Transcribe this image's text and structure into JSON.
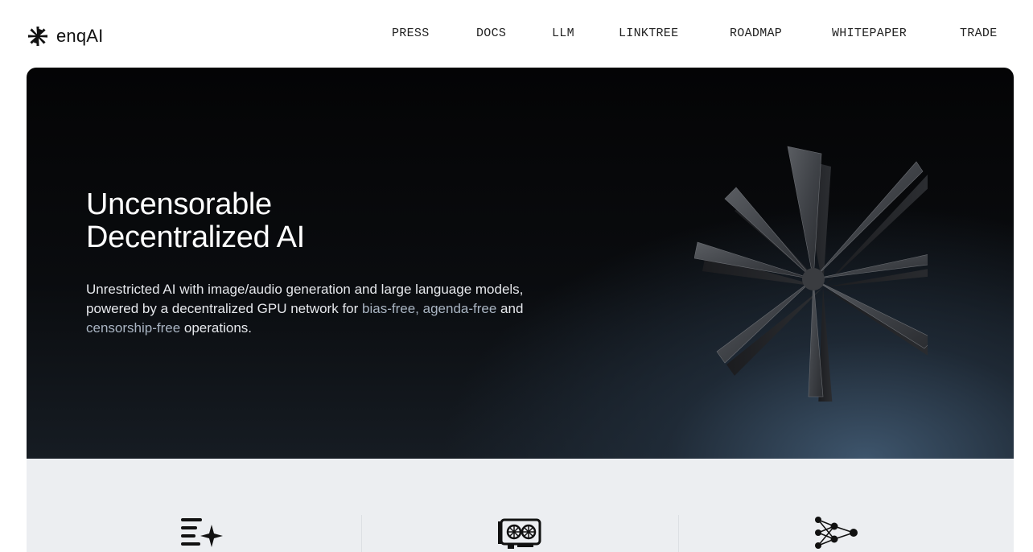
{
  "brand": {
    "name": "enqAI",
    "logo_icon": "asterisk-logo-icon"
  },
  "nav": {
    "links": [
      {
        "label": "PRESS"
      },
      {
        "label": "DOCS"
      },
      {
        "label": "LLM"
      },
      {
        "label": "LINKTREE"
      },
      {
        "label": "ROADMAP"
      },
      {
        "label": "WHITEPAPER"
      },
      {
        "label": "TRADE"
      }
    ]
  },
  "hero": {
    "title_line1": "Uncensorable",
    "title_line2": "Decentralized AI",
    "desc_part1": "Unrestricted AI with image/audio generation and large language models, powered by a decentralized GPU network for ",
    "desc_highlight1": "bias-free,",
    "desc_part2": " ",
    "desc_highlight2": "agenda-free",
    "desc_part3": " and ",
    "desc_highlight3": "censorship-free",
    "desc_part4": " operations.",
    "art_icon": "3d-asterisk-icon"
  },
  "features": {
    "icons": [
      "text-sparkle-icon",
      "gpu-card-icon",
      "neural-network-icon"
    ]
  },
  "colors": {
    "hero_bg": "#050607",
    "hero_glow": "#40586f",
    "highlight_text": "#a9b4c2",
    "features_bg": "#eceef1"
  }
}
